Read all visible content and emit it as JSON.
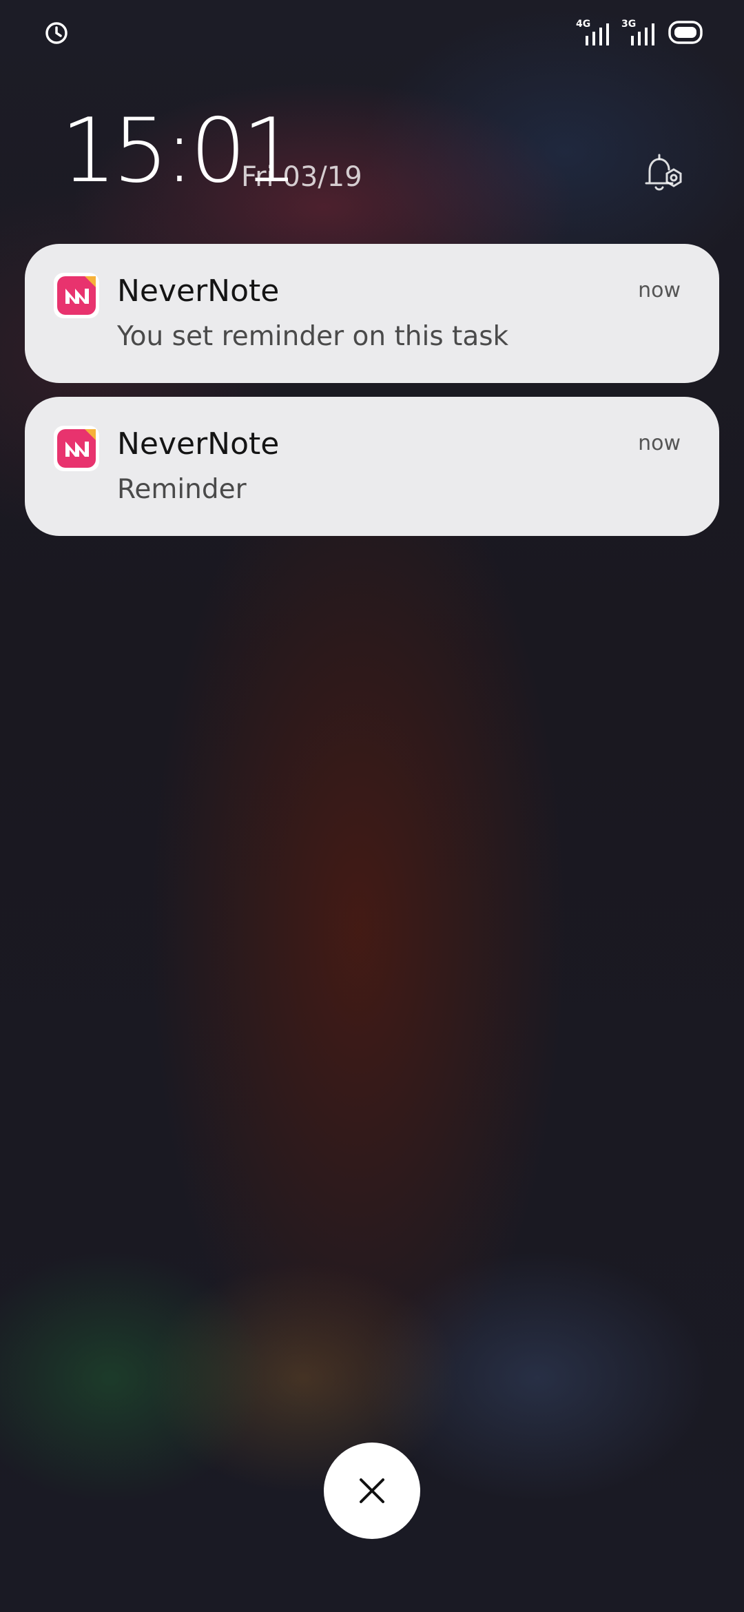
{
  "status_bar": {
    "left_icon": "alarm-clock-icon",
    "networks": [
      {
        "label": "4G",
        "icon": "signal-strength-icon"
      },
      {
        "label": "3G",
        "icon": "signal-strength-icon"
      }
    ],
    "battery_icon": "battery-icon"
  },
  "lock_screen": {
    "time": "15:01",
    "date": "Fri 03/19",
    "notification_settings_icon": "notification-settings-icon"
  },
  "notifications": [
    {
      "app_name": "NeverNote",
      "time": "now",
      "body": "You set reminder on this task",
      "icon": "nevernote-app-icon"
    },
    {
      "app_name": "NeverNote",
      "time": "now",
      "body": "Reminder",
      "icon": "nevernote-app-icon"
    }
  ],
  "dismiss": {
    "icon": "close-icon"
  },
  "colors": {
    "notification_bg": "#ebebed",
    "app_icon_primary": "#e8336e",
    "app_icon_accent": "#f6b13a",
    "text_primary": "#141414",
    "text_secondary": "#4a4a4a"
  }
}
